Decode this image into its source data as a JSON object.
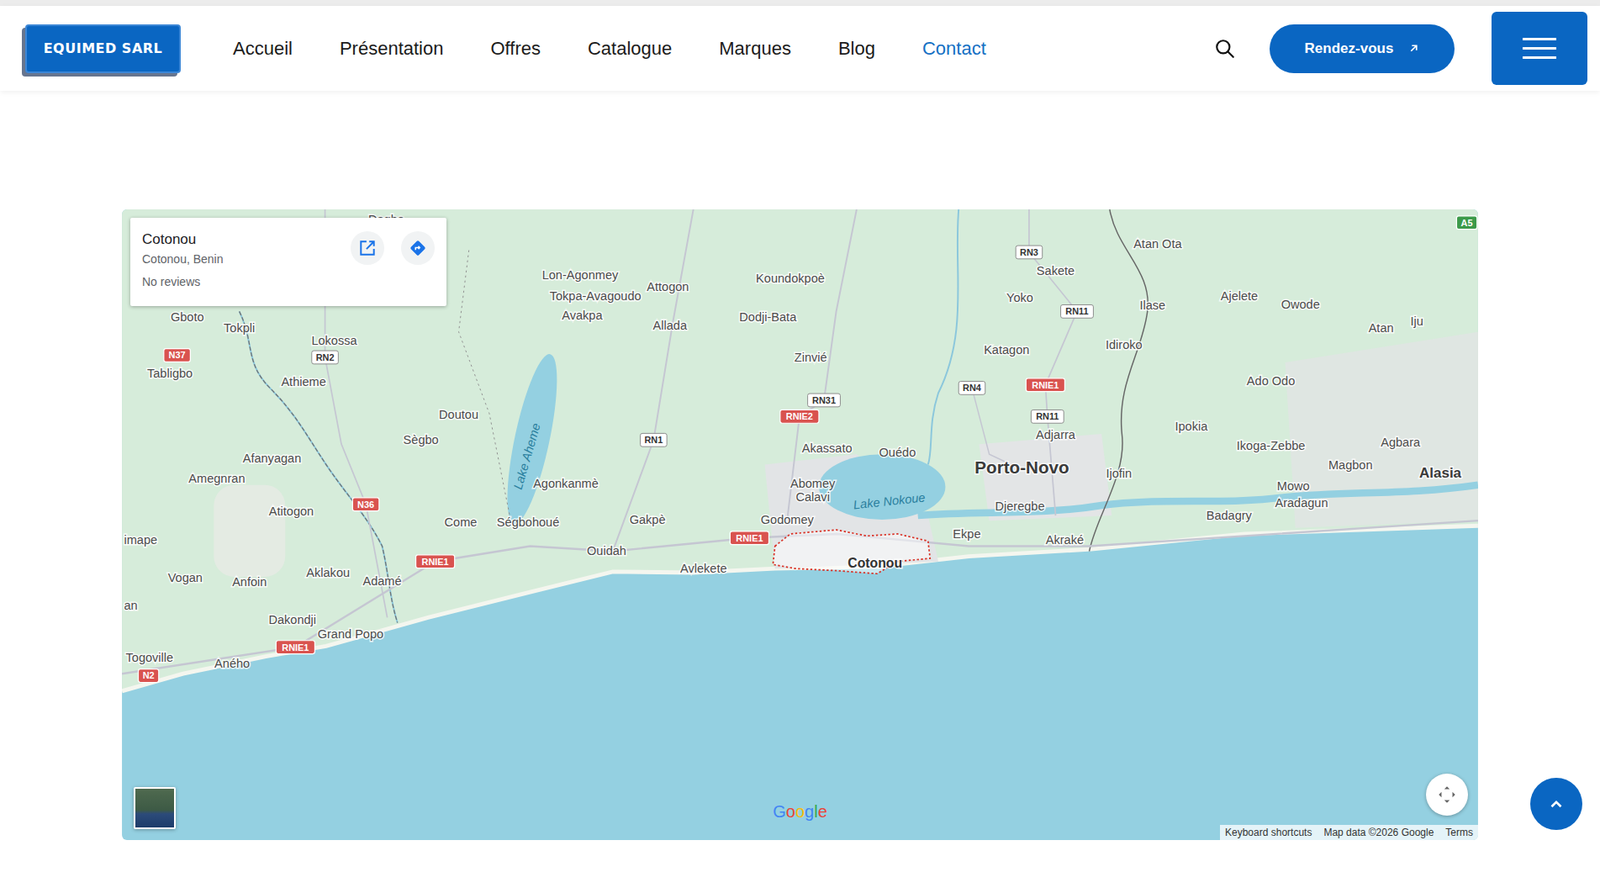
{
  "header": {
    "logo": "EQUIMED SARL",
    "nav": [
      {
        "label": "Accueil",
        "selected": false
      },
      {
        "label": "Présentation",
        "selected": false
      },
      {
        "label": "Offres",
        "selected": false
      },
      {
        "label": "Catalogue",
        "selected": false
      },
      {
        "label": "Marques",
        "selected": false
      },
      {
        "label": "Blog",
        "selected": false
      },
      {
        "label": "Contact",
        "selected": true
      }
    ],
    "cta": "Rendez-vous"
  },
  "map": {
    "place_card": {
      "title": "Cotonou",
      "subtitle": "Cotonou, Benin",
      "reviews": "No reviews"
    },
    "labels": [
      {
        "text": "Dogbo",
        "kind": "town"
      },
      {
        "text": "Lon-Agonmey",
        "kind": "town"
      },
      {
        "text": "Tokpa-Avagoudo",
        "kind": "town"
      },
      {
        "text": "Attogon",
        "kind": "town"
      },
      {
        "text": "Koundokpoè",
        "kind": "town"
      },
      {
        "text": "Avakpa",
        "kind": "town"
      },
      {
        "text": "Allada",
        "kind": "town"
      },
      {
        "text": "Dodji-Bata",
        "kind": "town"
      },
      {
        "text": "Zinvié",
        "kind": "town"
      },
      {
        "text": "Gboto",
        "kind": "town"
      },
      {
        "text": "Tokpli",
        "kind": "town"
      },
      {
        "text": "Lokossa",
        "kind": "town"
      },
      {
        "text": "Tabligbo",
        "kind": "town"
      },
      {
        "text": "Athieme",
        "kind": "town"
      },
      {
        "text": "Doutou",
        "kind": "town"
      },
      {
        "text": "Sègbo",
        "kind": "town"
      },
      {
        "text": "Afanyagan",
        "kind": "town"
      },
      {
        "text": "Amegnran",
        "kind": "town"
      },
      {
        "text": "Agonkanmè",
        "kind": "town"
      },
      {
        "text": "Atitogon",
        "kind": "town"
      },
      {
        "text": "Come",
        "kind": "town"
      },
      {
        "text": "Ségbohoué",
        "kind": "town"
      },
      {
        "text": "Gakpè",
        "kind": "town"
      },
      {
        "text": "Ouidah",
        "kind": "town"
      },
      {
        "text": "Avlekete",
        "kind": "town"
      },
      {
        "text": "Godomey",
        "kind": "town"
      },
      {
        "text": "Akassato",
        "kind": "town"
      },
      {
        "text": "Abomey",
        "kind": "town"
      },
      {
        "text": "Calavi",
        "kind": "town"
      },
      {
        "text": "Ouédo",
        "kind": "town"
      },
      {
        "text": "Ekpe",
        "kind": "town"
      },
      {
        "text": "Djeregbe",
        "kind": "town"
      },
      {
        "text": "Akraké",
        "kind": "town"
      },
      {
        "text": "Katagon",
        "kind": "town"
      },
      {
        "text": "Yoko",
        "kind": "town"
      },
      {
        "text": "Sakete",
        "kind": "town"
      },
      {
        "text": "Atan Ota",
        "kind": "town"
      },
      {
        "text": "Ilase",
        "kind": "town"
      },
      {
        "text": "Idiroko",
        "kind": "town"
      },
      {
        "text": "Adjarra",
        "kind": "town"
      },
      {
        "text": "Ijofin",
        "kind": "town"
      },
      {
        "text": "Ajelete",
        "kind": "town"
      },
      {
        "text": "Owode",
        "kind": "town"
      },
      {
        "text": "Atan",
        "kind": "town"
      },
      {
        "text": "Iju",
        "kind": "town"
      },
      {
        "text": "Ado Odo",
        "kind": "town"
      },
      {
        "text": "Ipokia",
        "kind": "town"
      },
      {
        "text": "Ikoga-Zebbe",
        "kind": "town"
      },
      {
        "text": "Agbara",
        "kind": "town"
      },
      {
        "text": "Magbon",
        "kind": "town"
      },
      {
        "text": "Mowo",
        "kind": "town"
      },
      {
        "text": "Aradagun",
        "kind": "town"
      },
      {
        "text": "Badagry",
        "kind": "town"
      },
      {
        "text": "Vogan",
        "kind": "town"
      },
      {
        "text": "Anfoin",
        "kind": "town"
      },
      {
        "text": "Aklakou",
        "kind": "town"
      },
      {
        "text": "Adamé",
        "kind": "town"
      },
      {
        "text": "Dakondji",
        "kind": "town"
      },
      {
        "text": "Grand Popo",
        "kind": "town"
      },
      {
        "text": "Togoville",
        "kind": "town"
      },
      {
        "text": "Aného",
        "kind": "town"
      },
      {
        "text": "imape",
        "kind": "edge"
      },
      {
        "text": "an",
        "kind": "edge"
      },
      {
        "text": "Cotonou",
        "kind": "city"
      },
      {
        "text": "Porto-Novo",
        "kind": "capital"
      },
      {
        "text": "Alasia",
        "kind": "region"
      },
      {
        "text": "Lake Aheme",
        "kind": "water"
      },
      {
        "text": "Lake Nokoue",
        "kind": "water"
      }
    ],
    "shields": [
      {
        "text": "N37",
        "kind": "national"
      },
      {
        "text": "RN2",
        "kind": "route"
      },
      {
        "text": "N36",
        "kind": "national"
      },
      {
        "text": "RNIE1",
        "kind": "national"
      },
      {
        "text": "RNIE1",
        "kind": "national"
      },
      {
        "text": "N2",
        "kind": "national"
      },
      {
        "text": "RN1",
        "kind": "route"
      },
      {
        "text": "RNIE2",
        "kind": "national"
      },
      {
        "text": "RN31",
        "kind": "route"
      },
      {
        "text": "RNIE1",
        "kind": "national"
      },
      {
        "text": "RN3",
        "kind": "route"
      },
      {
        "text": "RN11",
        "kind": "route"
      },
      {
        "text": "RN4",
        "kind": "route"
      },
      {
        "text": "RNIE1",
        "kind": "national"
      },
      {
        "text": "RN11",
        "kind": "route"
      },
      {
        "text": "A5",
        "kind": "highway"
      }
    ],
    "logo": "Google",
    "footer_links": [
      "Keyboard shortcuts",
      "Map data ©2026 Google",
      "Terms"
    ]
  }
}
